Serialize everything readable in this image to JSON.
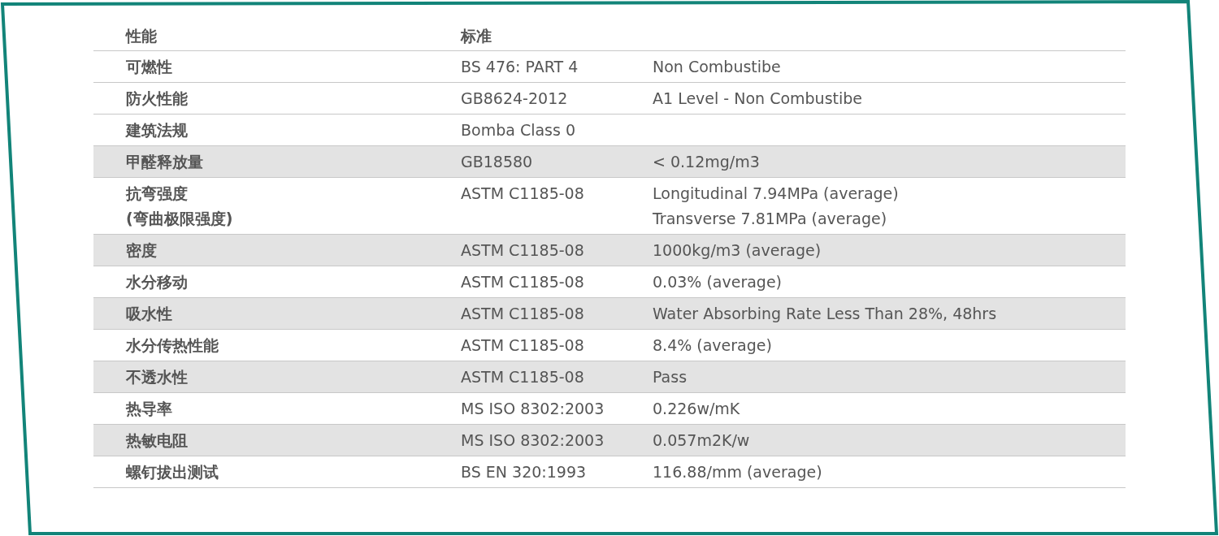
{
  "table": {
    "columns": [
      "性能",
      "标准"
    ],
    "rows": [
      {
        "property": "可燃性",
        "standard": "BS 476: PART 4",
        "value": "Non Combustibe",
        "highlighted": false
      },
      {
        "property": "防火性能",
        "standard": "GB8624-2012",
        "value": "A1 Level - Non Combustibe",
        "highlighted": false
      },
      {
        "property": "建筑法规",
        "standard": "Bomba Class 0",
        "highlighted": false
      },
      {
        "property": "甲醛释放量",
        "standard": "GB18580",
        "value": "< 0.12mg/m3",
        "highlighted": true
      },
      {
        "property": "抗弯强度\n(弯曲极限强度)",
        "standard": "ASTM C1185-08",
        "value": "Longitudinal 7.94MPa (average)\nTransverse 7.81MPa (average)",
        "highlighted": false
      },
      {
        "property": "密度",
        "standard": "ASTM C1185-08",
        "value": "1000kg/m3 (average)",
        "highlighted": true
      },
      {
        "property": "水分移动",
        "standard": "ASTM C1185-08",
        "value": "0.03% (average)",
        "highlighted": false
      },
      {
        "property": "吸水性",
        "standard": "ASTM C1185-08",
        "value": "Water Absorbing Rate Less Than 28%, 48hrs",
        "highlighted": true
      },
      {
        "property": "水分传热性能",
        "standard": "ASTM C1185-08",
        "value": "8.4% (average)",
        "highlighted": false
      },
      {
        "property": "不透水性",
        "standard": "ASTM C1185-08",
        "value": "Pass",
        "highlighted": true
      },
      {
        "property": "热导率",
        "standard": "MS ISO 8302:2003",
        "value": "0.226w/mK",
        "highlighted": false
      },
      {
        "property": "热敏电阻",
        "standard": "MS ISO 8302:2003",
        "value": "0.057m2K/w",
        "highlighted": true
      },
      {
        "property": "螺钉拔出测试",
        "standard": "BS EN 320:1993",
        "value": "116.88/mm (average)",
        "highlighted": false
      }
    ]
  }
}
